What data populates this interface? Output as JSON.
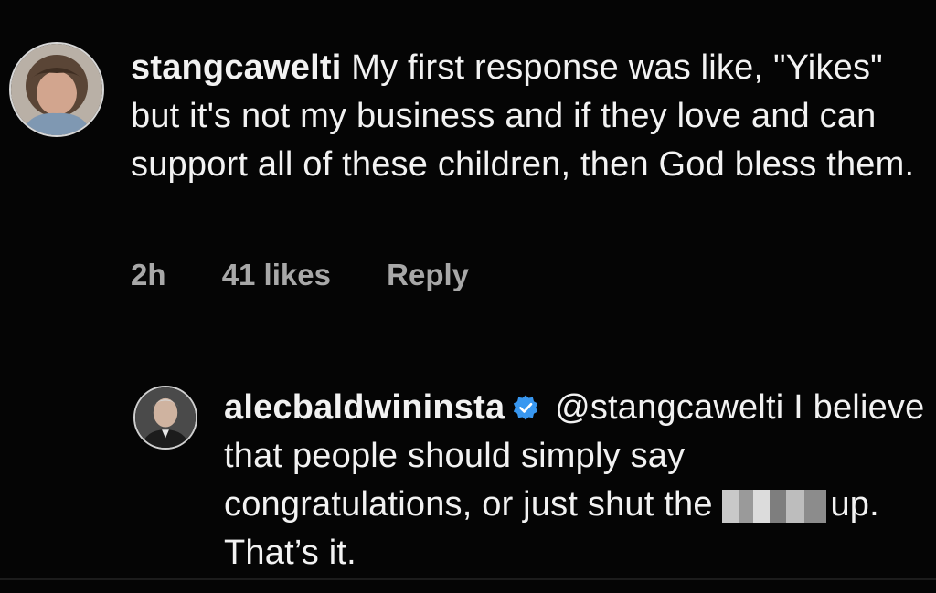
{
  "comments": [
    {
      "username": "stangcawelti",
      "text": "My first response was like, \"Yikes\" but it's not my business and if they love and can support all of these children, then God bless them.",
      "time": "2h",
      "likes": "41 likes",
      "reply_label": "Reply",
      "avatar_icon": "user-avatar-icon"
    },
    {
      "username": "alecbaldwininsta",
      "verified_icon": "verified-badge-icon",
      "mention": "@stangcawelti",
      "text_part1": "I believe that people should simply say congratulations, or just shut the",
      "censored_icon": "censored-blur",
      "text_part2": "up. That’s it.",
      "avatar_icon": "user-avatar-icon"
    }
  ],
  "colors": {
    "background": "#050505",
    "text": "#f2f2f2",
    "meta": "#a8a8a8",
    "verified": "#3897f0"
  }
}
